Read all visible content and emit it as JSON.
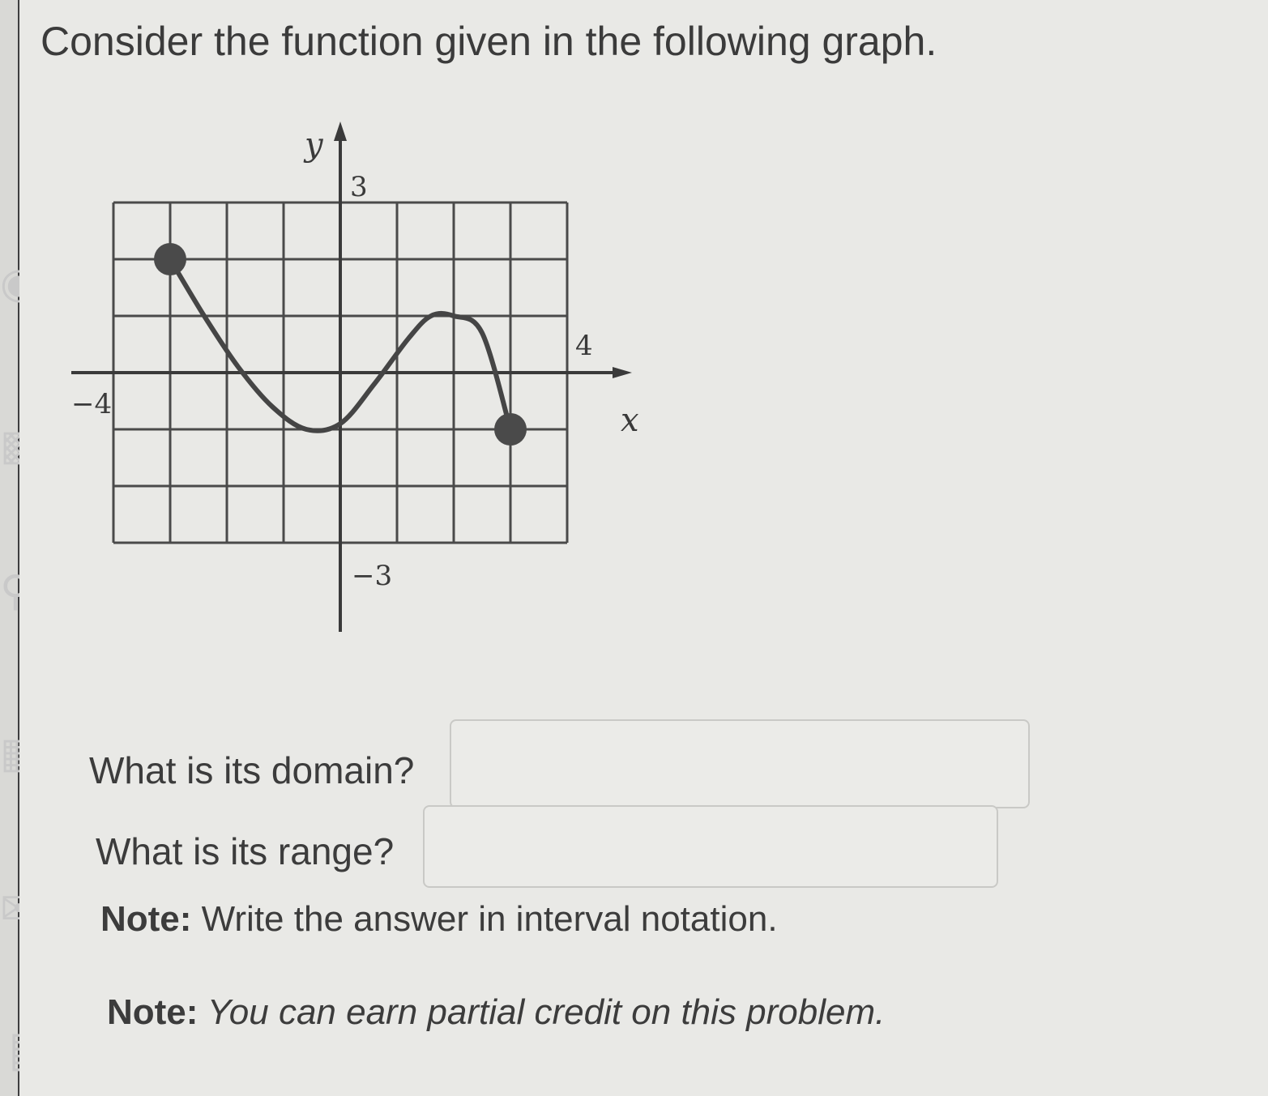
{
  "page": {
    "title": "Consider the function given in the following graph."
  },
  "graph": {
    "y_axis_label": "y",
    "x_axis_label": "x",
    "tick_labels": {
      "y_top": "3",
      "y_bottom": "−3",
      "x_left": "−4",
      "x_right": "4"
    }
  },
  "chart_data": {
    "type": "line",
    "xlabel": "x",
    "ylabel": "y",
    "xlim": [
      -4,
      4
    ],
    "ylim": [
      -3,
      3
    ],
    "grid": true,
    "tick_labels": [
      "-4",
      "4",
      "3",
      "-3"
    ],
    "series": [
      {
        "x": [
          -3,
          -2.4,
          -1.8,
          -1.2,
          -0.6,
          0,
          0.6,
          1.2,
          1.6,
          2,
          2.5,
          3
        ],
        "values": [
          2,
          1.0,
          0.1,
          -0.6,
          -1.0,
          -0.9,
          -0.2,
          0.6,
          1.0,
          1.0,
          0.7,
          -1
        ],
        "closed_endpoints": [
          [
            -3,
            2
          ],
          [
            3,
            -1
          ]
        ]
      }
    ]
  },
  "questions": {
    "domain_label": "What is its domain?",
    "range_label": "What is its range?"
  },
  "notes": {
    "note_label": "Note:",
    "note1_text": " Write the answer in interval notation.",
    "note2_text": " You can earn partial credit on this problem."
  },
  "colors": {
    "background": "#e9e9e6",
    "sidebar": "#3e3e40",
    "curve": "#454545",
    "grid": "#4a4a4a"
  }
}
